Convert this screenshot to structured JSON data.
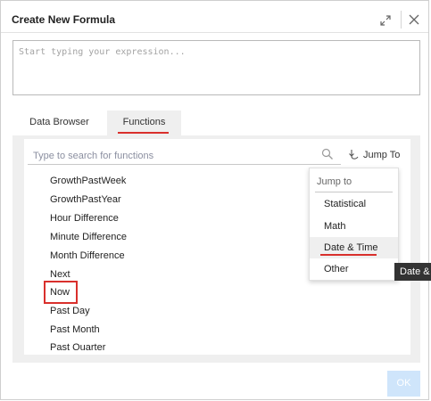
{
  "dialog": {
    "title": "Create New Formula",
    "expand_icon": "expand-diagonal-icon",
    "close_icon": "close-icon"
  },
  "expression": {
    "placeholder": "Start typing your expression...",
    "value": ""
  },
  "tabs": [
    {
      "label": "Data Browser",
      "active": false
    },
    {
      "label": "Functions",
      "active": true
    }
  ],
  "search": {
    "placeholder": "Type to search for functions",
    "value": "",
    "icon": "search-icon"
  },
  "jump_to": {
    "label": "Jump To",
    "icon": "jump-to-icon"
  },
  "functions": [
    "GrowthPastWeek",
    "GrowthPastYear",
    "Hour Difference",
    "Minute Difference",
    "Month Difference",
    "Next",
    "Now",
    "Past Day",
    "Past Month",
    "Past Quarter"
  ],
  "highlighted_function": "Now",
  "jump_menu": {
    "header": "Jump to",
    "items": [
      "Statistical",
      "Math",
      "Date & Time",
      "Other"
    ],
    "active": "Date & Time"
  },
  "tooltip": {
    "text": "Date & Time"
  },
  "footer": {
    "ok_label": "OK"
  },
  "colors": {
    "accent_red": "#d9302c",
    "ok_disabled": "#cfe5fb",
    "panel_bg": "#efefef"
  }
}
